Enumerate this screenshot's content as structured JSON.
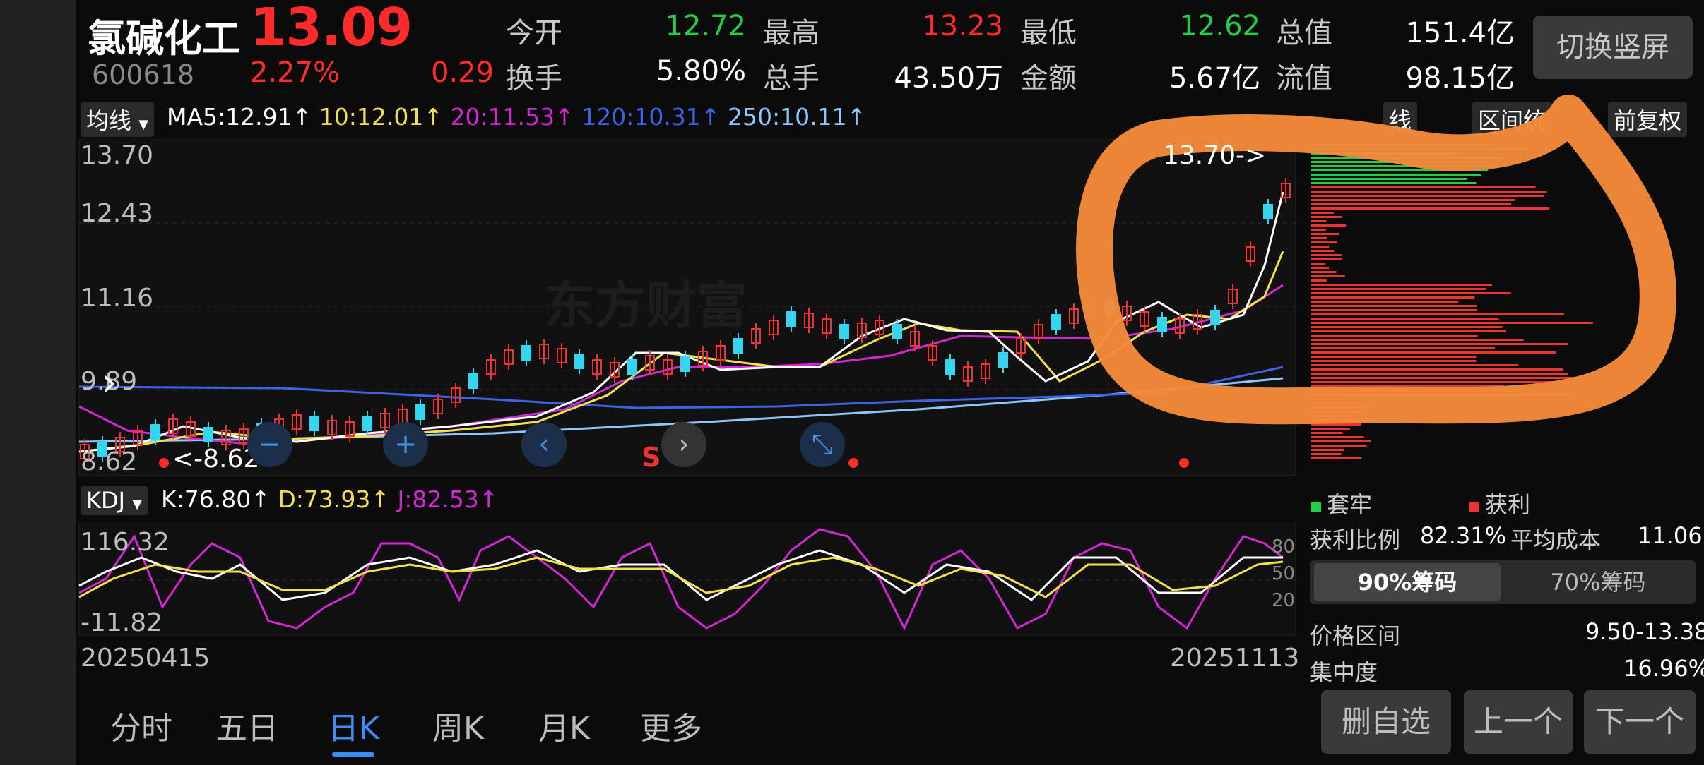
{
  "header": {
    "name": "氯碱化工",
    "price": "13.09",
    "code": "600618",
    "pct": "2.27%",
    "change": "0.29",
    "stats": [
      {
        "label": "今开",
        "value": "12.72",
        "color": "green"
      },
      {
        "label": "最高",
        "value": "13.23",
        "color": "red"
      },
      {
        "label": "最低",
        "value": "12.62",
        "color": "green"
      },
      {
        "label": "总值",
        "value": "151.4亿",
        "color": "white"
      },
      {
        "label": "换手",
        "value": "5.80%",
        "color": "white"
      },
      {
        "label": "总手",
        "value": "43.50万",
        "color": "white"
      },
      {
        "label": "金额",
        "value": "5.67亿",
        "color": "white"
      },
      {
        "label": "流值",
        "value": "98.15亿",
        "color": "white"
      }
    ],
    "switch_label": "切换竖屏"
  },
  "ma": {
    "selector": "均线",
    "ma5": "MA5:12.91↑",
    "ma10": "10:12.01↑",
    "ma20": "20:11.53↑",
    "ma120": "120:10.31↑",
    "ma250": "250:10.11↑",
    "colors": {
      "ma5": "#ffffff",
      "ma10": "#f4e04a",
      "ma20": "#d426d4",
      "ma120": "#3d63e6",
      "ma250": "#8cc8ff"
    }
  },
  "top_buttons": {
    "partial": "线",
    "interval": "区间统",
    "restore": "前复权"
  },
  "main_chart": {
    "y_ticks": [
      "13.70",
      "12.43",
      "11.16",
      "9.89",
      "8.62"
    ],
    "high_label": "13.70->",
    "low_label": "<-8.62",
    "s_marker": "S"
  },
  "watermark": "东方财富",
  "kdj": {
    "selector": "KDJ",
    "k": "K:76.80↑",
    "d": "D:73.93↑",
    "j": "J:82.53↑",
    "y_ticks": [
      "116.32",
      "-11.82"
    ],
    "right_ticks": [
      "80",
      "50",
      "20"
    ],
    "colors": {
      "k": "#ffffff",
      "d": "#f4e04a",
      "j": "#d426d4"
    }
  },
  "dates": {
    "start": "20250415",
    "end": "20251113"
  },
  "tabs": [
    "分时",
    "五日",
    "日K",
    "周K",
    "月K",
    "更多"
  ],
  "active_tab": "日K",
  "chips": {
    "legend_trapped": "套牢",
    "legend_profit": "获利",
    "profit_ratio_label": "获利比例",
    "profit_ratio": "82.31%",
    "avg_cost_label": "平均成本",
    "avg_cost": "11.06",
    "tab90": "90%筹码",
    "tab70": "70%筹码",
    "range_label": "价格区间",
    "range": "9.50-13.38",
    "conc_label": "集中度",
    "conc": "16.96%"
  },
  "bottom_buttons": [
    "删自选",
    "上一个",
    "下一个"
  ],
  "chart_data": {
    "type": "candlestick",
    "x_range": [
      "20250415",
      "20251113"
    ],
    "ylim": [
      8.62,
      13.7
    ],
    "last_close": 13.09,
    "kdj_ylim": [
      -11.82,
      116.32
    ]
  }
}
